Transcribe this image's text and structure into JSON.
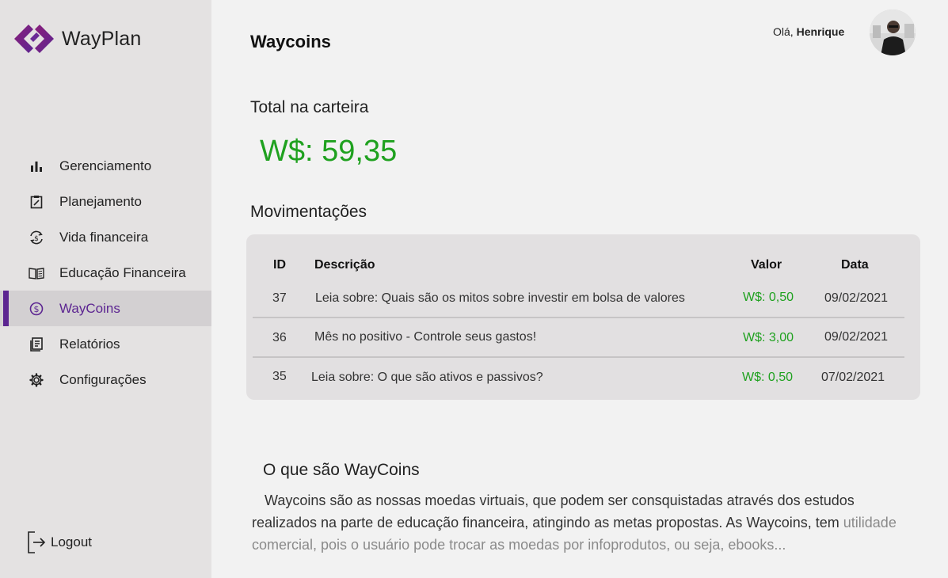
{
  "app": {
    "name": "WayPlan"
  },
  "header": {
    "title": "Waycoins",
    "greeting_prefix": "Olá,",
    "user_name": "Henrique"
  },
  "sidebar": {
    "items": [
      {
        "label": "Gerenciamento",
        "icon": "bar-chart-icon"
      },
      {
        "label": "Planejamento",
        "icon": "clipboard-edit-icon"
      },
      {
        "label": "Vida financeira",
        "icon": "currency-cycle-icon"
      },
      {
        "label": "Educação Financeira",
        "icon": "open-book-icon"
      },
      {
        "label": "WayCoins",
        "icon": "coin-dollar-icon",
        "active": true
      },
      {
        "label": "Relatórios",
        "icon": "report-icon"
      },
      {
        "label": "Configurações",
        "icon": "gear-icon"
      }
    ],
    "logout_label": "Logout"
  },
  "wallet": {
    "label": "Total na carteira",
    "value": "W$: 59,35"
  },
  "movements": {
    "label": "Movimentações",
    "columns": [
      "ID",
      "Descrição",
      "Valor",
      "Data"
    ],
    "rows": [
      {
        "id": "37",
        "description": "Leia sobre: Quais são os mitos sobre investir em bolsa de valores",
        "value": "W$: 0,50",
        "date": "09/02/2021"
      },
      {
        "id": "36",
        "description": "Mês no positivo - Controle seus gastos!",
        "value": "W$: 3,00",
        "date": "09/02/2021"
      },
      {
        "id": "35",
        "description": "Leia sobre: O que são ativos e passivos?",
        "value": "W$: 0,50",
        "date": "07/02/2021"
      }
    ]
  },
  "about": {
    "title": "O que são WayCoins",
    "text_main": "Waycoins são as nossas moedas virtuais, que podem ser consquistadas através dos estudos realizados na parte de educação financeira, atingindo as metas propostas. As Waycoins, tem",
    "text_faded": "utilidade comercial, pois o usuário pode trocar as moedas por infoprodutos, ou seja, ebooks..."
  },
  "colors": {
    "accent": "#5c2591",
    "positive": "#1fa11f",
    "sidebar_bg": "#e4e2e2"
  }
}
